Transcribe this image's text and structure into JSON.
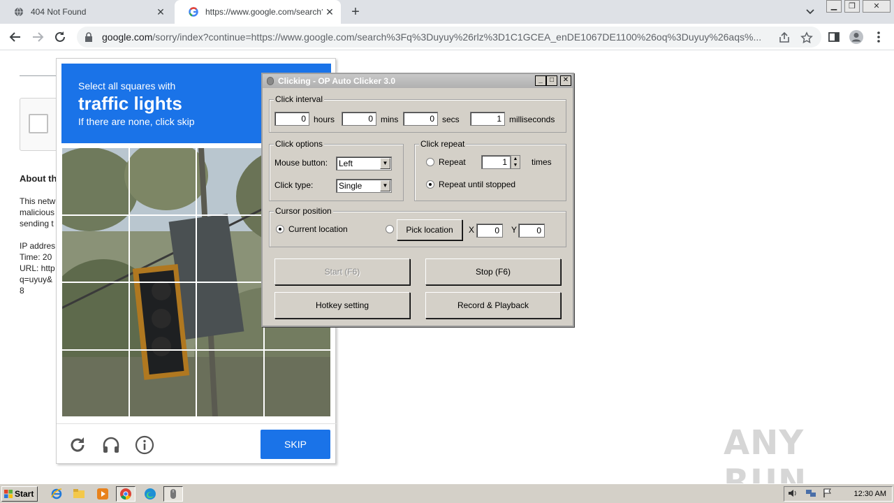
{
  "browser": {
    "tabs": [
      {
        "title": "404 Not Found"
      },
      {
        "title": "https://www.google.com/search?q="
      }
    ],
    "new_tab": "+",
    "close_glyph": "✕",
    "url_host": "google.com",
    "url_rest": "/sorry/index?continue=https://www.google.com/search%3Fq%3Duyuy%26rlz%3D1C1GCEA_enDE1067DE1100%26oq%3Duyuy%26aqs%..."
  },
  "page": {
    "about_heading": "About th",
    "para": [
      "This netw",
      "malicious",
      "sending t"
    ],
    "info": [
      "IP addres",
      "Time: 20",
      "URL: http",
      "q=uyuy&",
      "8"
    ]
  },
  "captcha": {
    "line1": "Select all squares with",
    "line2": "traffic lights",
    "line3": "If there are none, click skip",
    "skip": "SKIP"
  },
  "clicker": {
    "title": "Clicking - OP Auto Clicker 3.0",
    "interval": {
      "label": "Click interval",
      "hours": "0",
      "hours_label": "hours",
      "mins": "0",
      "mins_label": "mins",
      "secs": "0",
      "secs_label": "secs",
      "ms": "1",
      "ms_label": "milliseconds"
    },
    "options": {
      "label": "Click options",
      "mouse_label": "Mouse button:",
      "mouse_value": "Left",
      "type_label": "Click type:",
      "type_value": "Single"
    },
    "repeat": {
      "label": "Click repeat",
      "repeat_label": "Repeat",
      "repeat_value": "1",
      "times_label": "times",
      "until_label": "Repeat until stopped"
    },
    "cursor": {
      "label": "Cursor position",
      "current_label": "Current location",
      "pick_label": "Pick location",
      "x_label": "X",
      "x_value": "0",
      "y_label": "Y",
      "y_value": "0"
    },
    "buttons": {
      "start": "Start (F6)",
      "stop": "Stop (F6)",
      "hotkey": "Hotkey setting",
      "record": "Record & Playback"
    }
  },
  "watermark": "ANY RUN",
  "taskbar": {
    "start": "Start",
    "clock": "12:30 AM"
  }
}
